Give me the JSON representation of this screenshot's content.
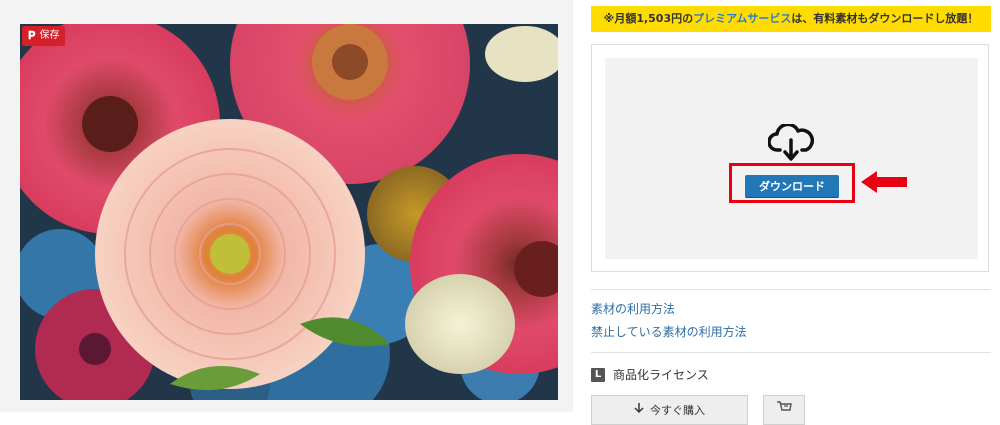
{
  "photo": {
    "description_icon": "flower-bouquet-photo",
    "save_button": {
      "icon": "pinterest-icon",
      "glyph": "𝐏",
      "label": "保存"
    }
  },
  "promo": {
    "prefix": "※月額1,503円の",
    "highlight": "プレミアムサービス",
    "suffix": "は、有料素材もダウンロードし放題！",
    "background_color": "#ffdc00",
    "accent_color": "#2b7bc2"
  },
  "download": {
    "icon": "cloud-download-icon",
    "button_label": "ダウンロード",
    "button_color": "#2277b6",
    "highlight_color": "#e60012",
    "pointer_icon": "red-arrow-left-icon"
  },
  "links": [
    {
      "label": "素材の利用方法"
    },
    {
      "label": "禁止している素材の利用方法"
    }
  ],
  "license": {
    "badge": "L",
    "label": "商品化ライセンス"
  },
  "buy": {
    "icon": "download-arrow-icon",
    "label": "今すぐ購入"
  },
  "cart": {
    "icon": "cart-icon"
  }
}
